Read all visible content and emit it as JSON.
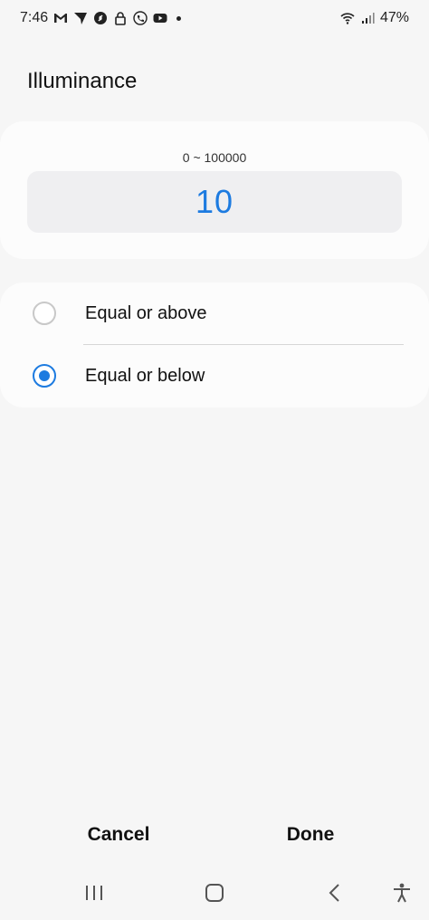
{
  "status_bar": {
    "time": "7:46",
    "battery": "47%",
    "left_icons": [
      "gmail-icon",
      "location-arrow-icon",
      "shazam-icon",
      "lock-icon",
      "phone-call-icon",
      "youtube-icon"
    ],
    "right_icons": [
      "wifi-icon",
      "signal-icon"
    ]
  },
  "header": {
    "title": "Illuminance"
  },
  "range": {
    "label": "0 ~ 100000",
    "value": "10"
  },
  "options": [
    {
      "label": "Equal or above",
      "checked": false
    },
    {
      "label": "Equal or below",
      "checked": true
    }
  ],
  "actions": {
    "cancel": "Cancel",
    "done": "Done"
  },
  "nav_icons": [
    "recent-apps-icon",
    "home-icon",
    "back-icon",
    "accessibility-icon"
  ],
  "colors": {
    "accent": "#1d7be0",
    "background": "#f6f6f6",
    "card": "#fcfcfc",
    "value_box": "#efeff1"
  }
}
